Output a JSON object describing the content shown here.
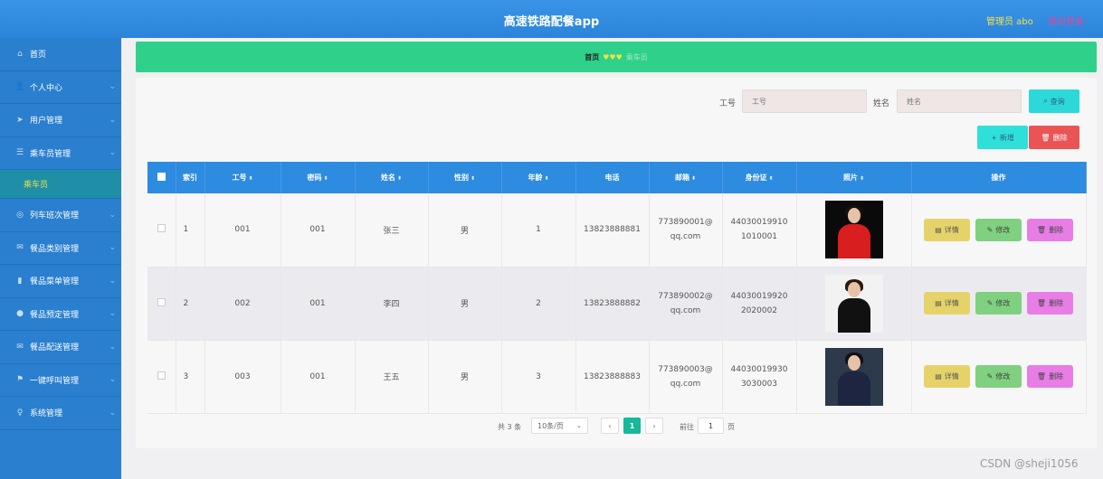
{
  "header": {
    "title": "高速铁路配餐app",
    "admin": "管理员 abo",
    "logout": "退出登录"
  },
  "sidebar": {
    "items": [
      {
        "label": "首页",
        "icon": "home-icon",
        "glyph": "⌂",
        "chevron": false
      },
      {
        "label": "个人中心",
        "icon": "user-icon",
        "glyph": "👤",
        "chevron": true
      },
      {
        "label": "用户管理",
        "icon": "send-icon",
        "glyph": "➤",
        "chevron": true
      },
      {
        "label": "乘车员管理",
        "icon": "list-icon",
        "glyph": "☰",
        "chevron": true
      },
      {
        "label": "乘车员",
        "icon": "",
        "glyph": "",
        "chevron": false,
        "sub": true
      },
      {
        "label": "列车班次管理",
        "icon": "globe-icon",
        "glyph": "◎",
        "chevron": true
      },
      {
        "label": "餐品类别管理",
        "icon": "mail-icon",
        "glyph": "✉",
        "chevron": true
      },
      {
        "label": "餐品菜单管理",
        "icon": "chart-icon",
        "glyph": "▮",
        "chevron": true
      },
      {
        "label": "餐品预定管理",
        "icon": "location-icon",
        "glyph": "●",
        "chevron": true
      },
      {
        "label": "餐品配送管理",
        "icon": "envelope-icon",
        "glyph": "✉",
        "chevron": true
      },
      {
        "label": "一键呼叫管理",
        "icon": "flag-icon",
        "glyph": "⚑",
        "chevron": true
      },
      {
        "label": "系统管理",
        "icon": "bulb-icon",
        "glyph": "♀",
        "chevron": true
      }
    ]
  },
  "breadcrumb": {
    "home": "首页",
    "separator": "♥♥♥",
    "current": "乘车员"
  },
  "search": {
    "fields": [
      {
        "label": "工号",
        "placeholder": "工号"
      },
      {
        "label": "姓名",
        "placeholder": "姓名"
      }
    ],
    "button": "查询"
  },
  "actions": {
    "add": "新增",
    "delete": "删除"
  },
  "table": {
    "headers": [
      "索引",
      "工号",
      "密码",
      "姓名",
      "性别",
      "年龄",
      "电话",
      "邮箱",
      "身份证",
      "照片",
      "操作"
    ],
    "sortable": [
      false,
      true,
      true,
      true,
      true,
      true,
      false,
      true,
      true,
      true,
      false
    ],
    "rows": [
      {
        "index": "1",
        "id": "001",
        "password": "001",
        "name": "张三",
        "gender": "男",
        "age": "1",
        "phone": "13823888881",
        "email": "773890001@qq.com",
        "idcard": "440300199101010001",
        "photo": "red-dress-woman"
      },
      {
        "index": "2",
        "id": "002",
        "password": "001",
        "name": "李四",
        "gender": "男",
        "age": "2",
        "phone": "13823888882",
        "email": "773890002@qq.com",
        "idcard": "440300199202020002",
        "photo": "black-suit-woman"
      },
      {
        "index": "3",
        "id": "003",
        "password": "001",
        "name": "王五",
        "gender": "男",
        "age": "3",
        "phone": "13823888883",
        "email": "773890003@qq.com",
        "idcard": "440300199303030003",
        "photo": "dark-suit-man"
      }
    ],
    "ops": {
      "detail": "详情",
      "edit": "修改",
      "delete": "删除"
    }
  },
  "pagination": {
    "total": "共 3 条",
    "page_size": "10条/页",
    "current_page": "1",
    "goto_label": "前往",
    "goto_value": "1",
    "page_suffix": "页"
  },
  "watermark": "CSDN @sheji1056",
  "colors": {
    "header": "#2d8be0",
    "sidebar": "#2a7fcf",
    "breadcrumb": "#2fd18a",
    "pager_active": "#18b898"
  }
}
